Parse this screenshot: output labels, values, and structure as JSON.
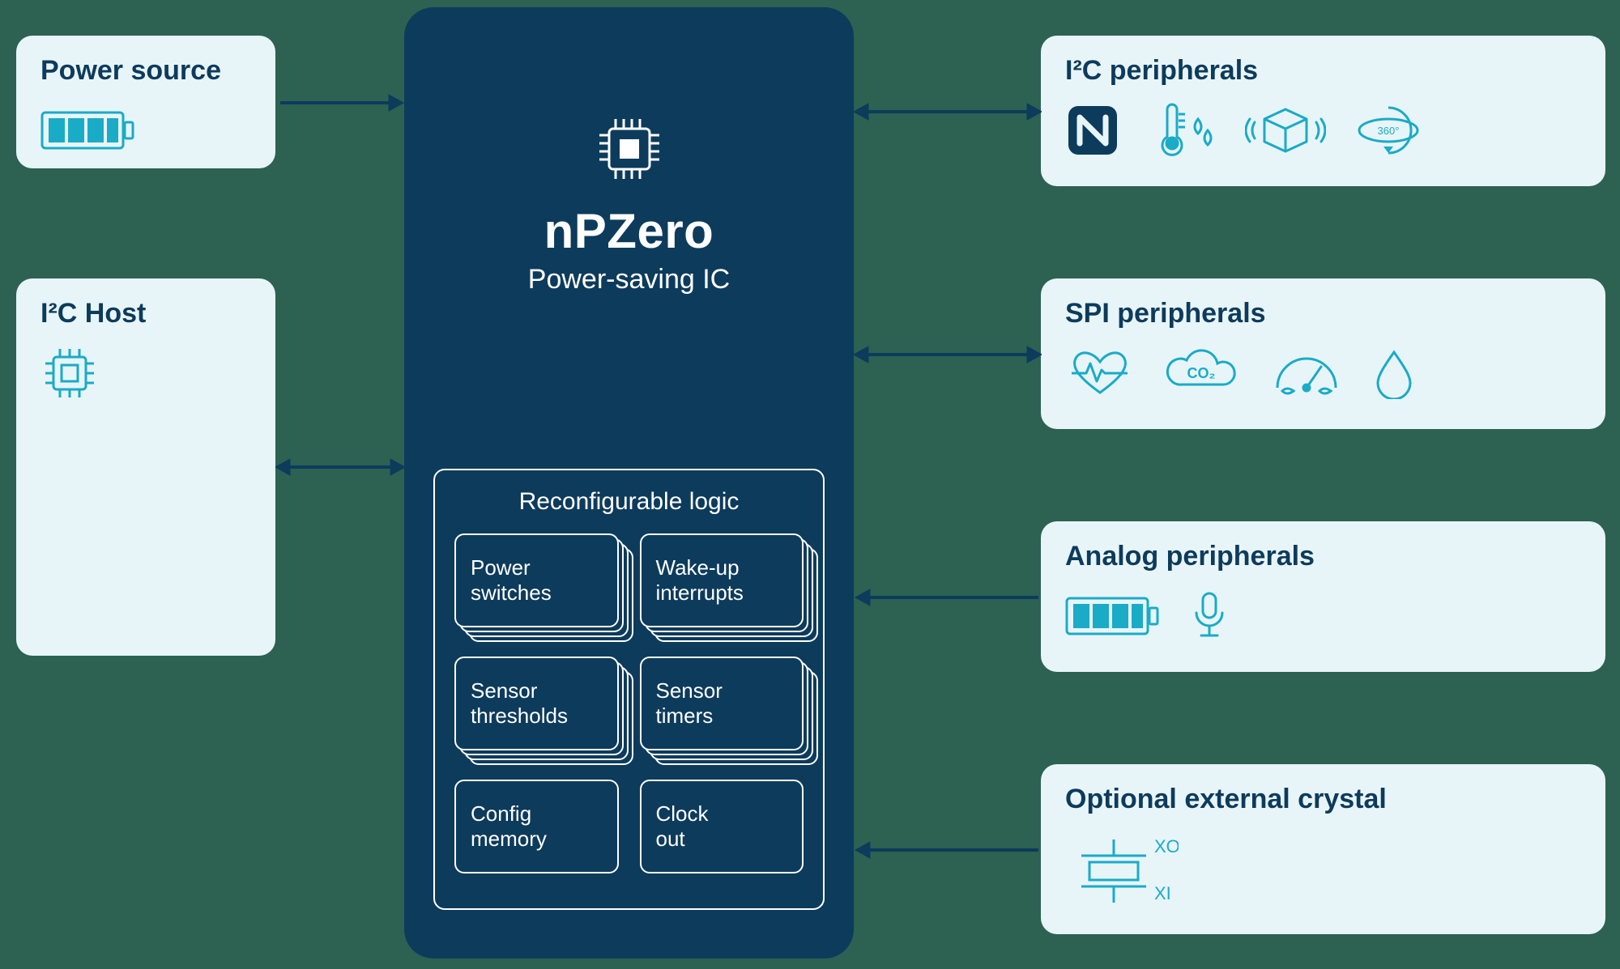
{
  "left": {
    "power_source": {
      "title": "Power source",
      "icon": "battery-icon"
    },
    "i2c_host": {
      "title": "I²C Host",
      "icon": "chip-icon"
    }
  },
  "center": {
    "title": "nPZero",
    "subtitle": "Power-saving IC",
    "icon": "chip-icon",
    "logic": {
      "title": "Reconfigurable logic",
      "cells": [
        {
          "label": "Power\nswitches",
          "stacked": true
        },
        {
          "label": "Wake-up\ninterrupts",
          "stacked": true
        },
        {
          "label": "Sensor\nthresholds",
          "stacked": true
        },
        {
          "label": "Sensor\ntimers",
          "stacked": true
        },
        {
          "label": "Config\nmemory",
          "stacked": false
        },
        {
          "label": "Clock\nout",
          "stacked": false
        }
      ]
    }
  },
  "right": {
    "i2c_peripherals": {
      "title": "I²C peripherals",
      "icons": [
        "nfc-icon",
        "temperature-humidity-icon",
        "vibration-package-icon",
        "rotation-360-icon"
      ]
    },
    "spi_peripherals": {
      "title": "SPI peripherals",
      "icons": [
        "heartrate-icon",
        "co2-icon",
        "air-quality-gauge-icon",
        "water-drop-icon"
      ]
    },
    "analog_peripherals": {
      "title": "Analog peripherals",
      "icons": [
        "battery-icon",
        "microphone-icon"
      ]
    },
    "crystal": {
      "title": "Optional external crystal",
      "labels": {
        "xo": "XO",
        "xi": "XI"
      },
      "icon": "crystal-icon"
    }
  },
  "connections": [
    {
      "from": "power_source",
      "to": "center",
      "direction": "uni-right"
    },
    {
      "from": "i2c_host",
      "to": "center",
      "direction": "bi"
    },
    {
      "from": "center",
      "to": "i2c_peripherals",
      "direction": "bi"
    },
    {
      "from": "center",
      "to": "spi_peripherals",
      "direction": "bi"
    },
    {
      "from": "analog_peripherals",
      "to": "center",
      "direction": "uni-left"
    },
    {
      "from": "crystal",
      "to": "center",
      "direction": "uni-left"
    }
  ],
  "colors": {
    "bg": "#2d6152",
    "card_bg": "#e8f5f8",
    "accent_dark": "#0d3b5c",
    "accent_cyan": "#1aabc7"
  }
}
